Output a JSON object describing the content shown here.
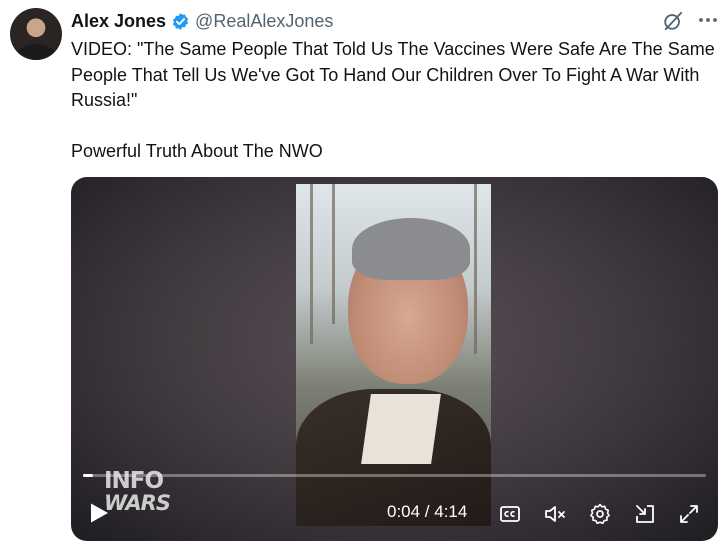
{
  "author": {
    "name": "Alex Jones",
    "handle": "@RealAlexJones",
    "verified": true,
    "verified_color": "#1d9bf0",
    "avatar_icon": "avatar"
  },
  "header_icons": [
    "grok-icon",
    "more-icon"
  ],
  "tweet": {
    "text": "VIDEO: \"The Same People That Told Us The Vaccines Were Safe Are The Same People That Tell Us We've Got To Hand Our Children Over To Fight A War With Russia!\"\n\nPowerful Truth About The NWO"
  },
  "video": {
    "watermark_line1": "INFO",
    "watermark_line2": "WARS",
    "time_display": "0:04 / 4:14",
    "progress": 0.016,
    "controls": [
      "play-icon",
      "captions-icon",
      "mute-icon",
      "settings-icon",
      "pip-icon",
      "fullscreen-icon"
    ]
  }
}
